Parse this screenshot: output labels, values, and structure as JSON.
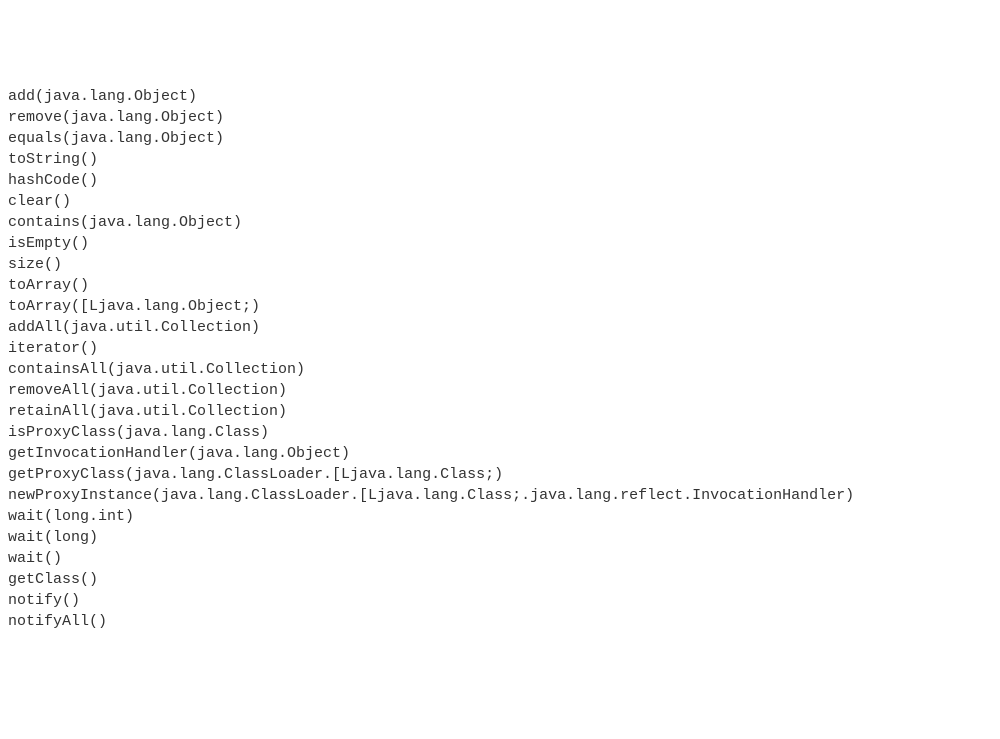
{
  "methods": [
    "add(java.lang.Object)",
    "remove(java.lang.Object)",
    "equals(java.lang.Object)",
    "toString()",
    "hashCode()",
    "clear()",
    "contains(java.lang.Object)",
    "isEmpty()",
    "size()",
    "toArray()",
    "toArray([Ljava.lang.Object;)",
    "addAll(java.util.Collection)",
    "iterator()",
    "containsAll(java.util.Collection)",
    "removeAll(java.util.Collection)",
    "retainAll(java.util.Collection)",
    "isProxyClass(java.lang.Class)",
    "getInvocationHandler(java.lang.Object)",
    "getProxyClass(java.lang.ClassLoader.[Ljava.lang.Class;)",
    "newProxyInstance(java.lang.ClassLoader.[Ljava.lang.Class;.java.lang.reflect.InvocationHandler)",
    "wait(long.int)",
    "wait(long)",
    "wait()",
    "getClass()",
    "notify()",
    "notifyAll()"
  ]
}
